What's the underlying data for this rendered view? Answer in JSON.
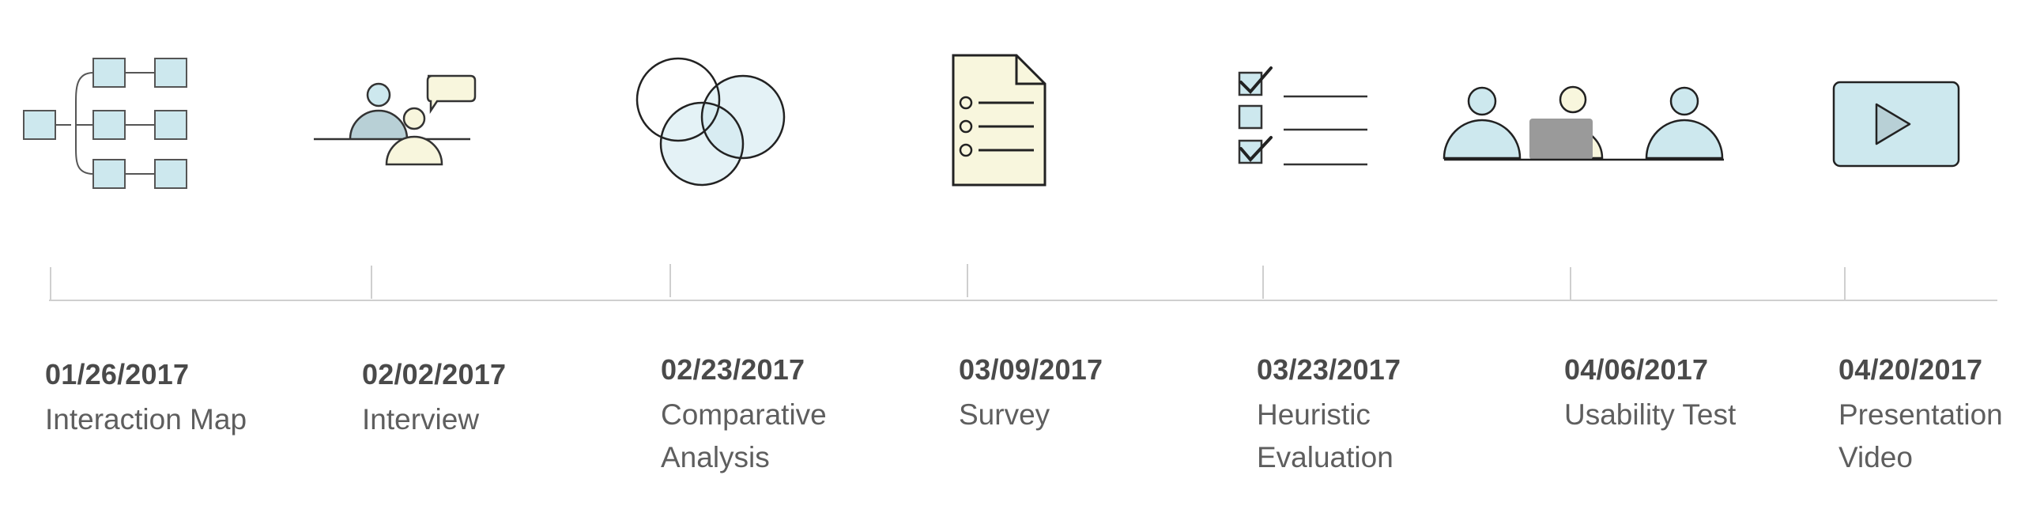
{
  "timeline": {
    "milestones": [
      {
        "date": "01/26/2017",
        "label": "Interaction Map",
        "icon": "interaction-map-icon"
      },
      {
        "date": "02/02/2017",
        "label": "Interview",
        "icon": "interview-icon"
      },
      {
        "date": "02/23/2017",
        "label": "Comparative Analysis",
        "icon": "venn-diagram-icon"
      },
      {
        "date": "03/09/2017",
        "label": "Survey",
        "icon": "survey-document-icon"
      },
      {
        "date": "03/23/2017",
        "label": "Heuristic Evaluation",
        "icon": "checklist-icon"
      },
      {
        "date": "04/06/2017",
        "label": "Usability Test",
        "icon": "usability-test-icon"
      },
      {
        "date": "04/20/2017",
        "label": "Presentation Video",
        "icon": "video-play-icon"
      }
    ]
  },
  "colors": {
    "light_blue": "#cde8ee",
    "cream": "#f8f6dd",
    "stroke": "#333333",
    "axis": "#cfcfcf",
    "date_text": "#4a4a4a",
    "label_text": "#5e5e5e"
  }
}
